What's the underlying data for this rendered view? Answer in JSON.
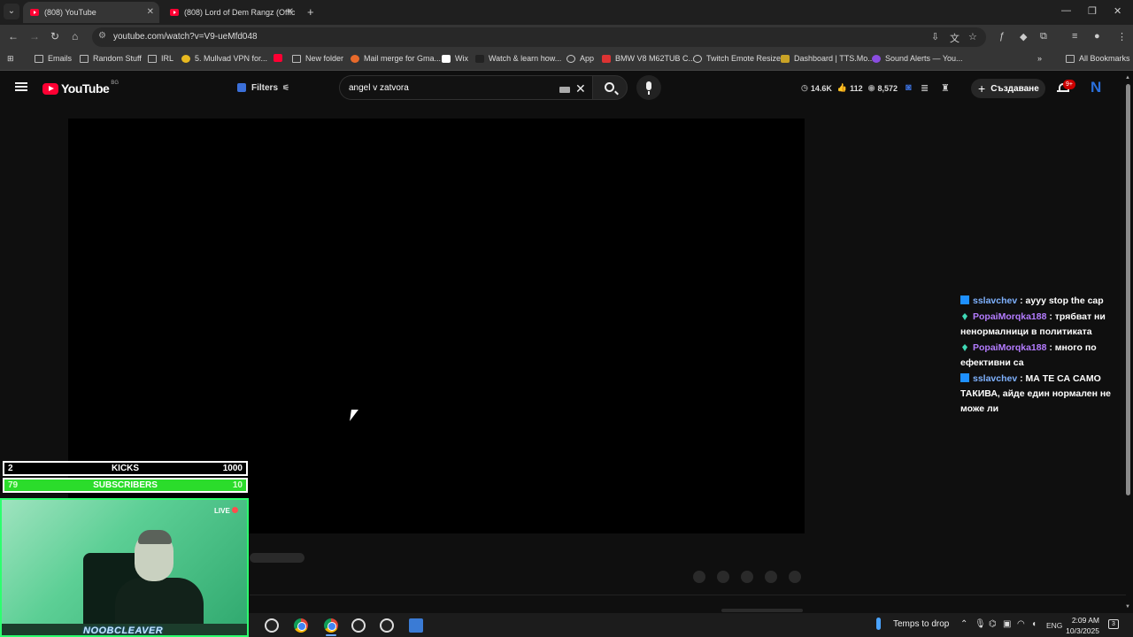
{
  "browser": {
    "tabs": [
      {
        "title": "(808) YouTube",
        "active": true
      },
      {
        "title": "(808) Lord of Dem Rangz (Offic",
        "active": false
      }
    ],
    "url": "youtube.com/watch?v=V9-ueMfd048",
    "bookmarks": [
      {
        "label": "Emails",
        "icon": "folder-icon"
      },
      {
        "label": "Random Stuff",
        "icon": "folder-icon"
      },
      {
        "label": "IRL",
        "icon": "folder-icon"
      },
      {
        "label": "5. Mullvad VPN for...",
        "icon": "mullvad-icon"
      },
      {
        "label": "",
        "icon": "youtube-icon"
      },
      {
        "label": "New folder",
        "icon": "folder-icon"
      },
      {
        "label": "Mail merge for Gma...",
        "icon": "mail-merge-icon"
      },
      {
        "label": "Wix",
        "icon": "wix-icon"
      },
      {
        "label": "Watch & learn how...",
        "icon": "page-icon"
      },
      {
        "label": "App",
        "icon": "globe-icon"
      },
      {
        "label": "BMW V8 M62TUB C...",
        "icon": "bmw-icon"
      },
      {
        "label": "Twitch Emote Resizer",
        "icon": "globe-icon"
      },
      {
        "label": "Dashboard | TTS.Mo...",
        "icon": "tts-icon"
      },
      {
        "label": "Sound Alerts — You...",
        "icon": "sound-alerts-icon"
      }
    ],
    "all_bookmarks": "All Bookmarks"
  },
  "youtube": {
    "logo_text": "YouTube",
    "country_code": "BG",
    "filters_label": "Filters",
    "search_query": "angel v zatvora",
    "stats": {
      "views": "14.6K",
      "likes": "112",
      "other": "8,572"
    },
    "create_label": "Създаване",
    "notifications_badge": "9+",
    "avatar_letter": "N"
  },
  "chat": [
    {
      "user": "sslavchev",
      "user_color": "#7fb2ff",
      "badge": "blue",
      "text": ": ayyy stop the cap"
    },
    {
      "user": "PopaiMorqka188",
      "user_color": "#b47cff",
      "badge": "gem",
      "text": ": трябват ни ненормалници в политиката"
    },
    {
      "user": "PopaiMorqka188",
      "user_color": "#b47cff",
      "badge": "gem",
      "text": ": много по ефективни са"
    },
    {
      "user": "sslavchev",
      "user_color": "#7fb2ff",
      "badge": "blue",
      "text": ": МА ТЕ СА САМО ТАКИВА, айде един нормален не може ли"
    }
  ],
  "overlay": {
    "kicks": {
      "current": "2",
      "label": "KICKS",
      "goal": "1000"
    },
    "subs": {
      "current": "79",
      "label": "SUBSCRIBERS",
      "goal": "10"
    },
    "live_label": "LIVE",
    "streamer_name": "NOOBCLEAVER"
  },
  "taskbar": {
    "weather": "Temps to drop",
    "language": "ENG",
    "time": "2:09 AM",
    "date": "10/3/2025",
    "notification_count": "3"
  },
  "colors": {
    "accent": "#ff0033",
    "subs_bar": "#2bdc2b",
    "webcam_border": "#2dff6e"
  }
}
